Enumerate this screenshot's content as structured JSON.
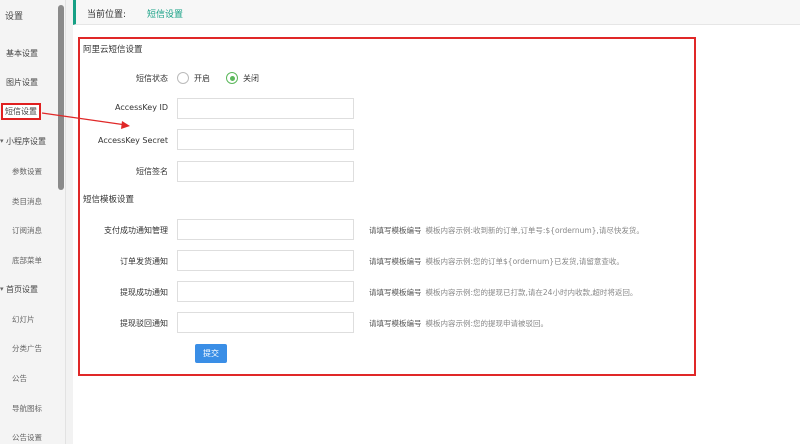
{
  "sidebar": {
    "title": "设置",
    "items": [
      {
        "label": "基本设置"
      },
      {
        "label": "图片设置"
      },
      {
        "label": "短信设置"
      },
      {
        "label": "小程序设置"
      },
      {
        "label": "参数设置"
      },
      {
        "label": "类目消息"
      },
      {
        "label": "订阅消息"
      },
      {
        "label": "底部菜单"
      },
      {
        "label": "首页设置"
      },
      {
        "label": "幻灯片"
      },
      {
        "label": "分类广告"
      },
      {
        "label": "公告"
      },
      {
        "label": "导航图标"
      },
      {
        "label": "公告设置"
      }
    ]
  },
  "breadcrumb": {
    "label": "当前位置:",
    "value": "短信设置"
  },
  "aliyun": {
    "section_title": "阿里云短信设置",
    "status_label": "短信状态",
    "status_options": [
      "开启",
      "关闭"
    ],
    "status_selected": "关闭",
    "accesskey_id_label": "AccessKey ID",
    "accesskey_id_value": "",
    "accesskey_secret_label": "AccessKey Secret",
    "accesskey_secret_value": "",
    "sign_label": "短信签名",
    "sign_value": ""
  },
  "templates": {
    "section_title": "短信模板设置",
    "rows": [
      {
        "label": "支付成功通知管理",
        "value": "",
        "hint": "请填写模板编号",
        "example": "模板内容示例:收到新的订单,订单号:${ordernum},请尽快发货。"
      },
      {
        "label": "订单发货通知",
        "value": "",
        "hint": "请填写模板编号",
        "example": "模板内容示例:您的订单${ordernum}已发货,请留意查收。"
      },
      {
        "label": "提现成功通知",
        "value": "",
        "hint": "请填写模板编号",
        "example": "模板内容示例:您的提现已打款,请在24小时内收款,超时将返回。"
      },
      {
        "label": "提现驳回通知",
        "value": "",
        "hint": "请填写模板编号",
        "example": "模板内容示例:您的提现申请被驳回。"
      }
    ]
  },
  "submit_label": "提交",
  "colors": {
    "accent": "#16a085",
    "highlight": "#e02828",
    "button": "#3a8ee6",
    "radio_checked": "#5cb85c"
  }
}
